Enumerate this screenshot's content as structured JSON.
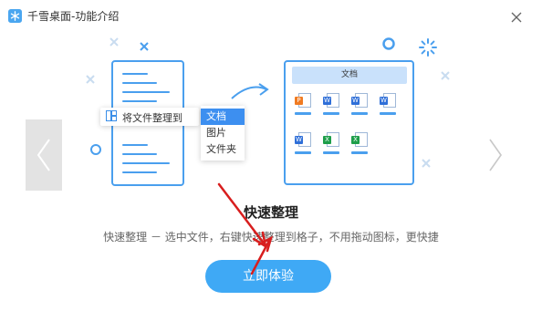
{
  "window": {
    "title": "千雪桌面-功能介绍"
  },
  "illustration": {
    "context_menu_label": "将文件整理到",
    "submenu_items": [
      "文档",
      "图片",
      "文件夹"
    ],
    "submenu_selected": "文档",
    "folder_title": "文档",
    "file_icons": [
      {
        "kind": "ppt",
        "badge": "P",
        "color": "#f07b22"
      },
      {
        "kind": "word",
        "badge": "W",
        "color": "#2f6fd8"
      },
      {
        "kind": "word",
        "badge": "W",
        "color": "#2f6fd8"
      },
      {
        "kind": "word",
        "badge": "W",
        "color": "#2f6fd8"
      },
      {
        "kind": "word",
        "badge": "W",
        "color": "#2f6fd8"
      },
      {
        "kind": "excel",
        "badge": "X",
        "color": "#1e9e4a"
      },
      {
        "kind": "excel",
        "badge": "X",
        "color": "#1e9e4a"
      }
    ]
  },
  "feature": {
    "heading": "快速整理",
    "description": "快速整理 － 选中文件，右键快速整理到格子，不用拖动图标，更快捷"
  },
  "cta": {
    "label": "立即体验"
  },
  "colors": {
    "accent": "#3fa9f5",
    "outline": "#4a9fee",
    "annotation_arrow": "#d81e1e"
  },
  "icons": {
    "app": "snowflake-icon",
    "close": "close-icon",
    "prev": "chevron-left-icon",
    "next": "chevron-right-icon"
  }
}
